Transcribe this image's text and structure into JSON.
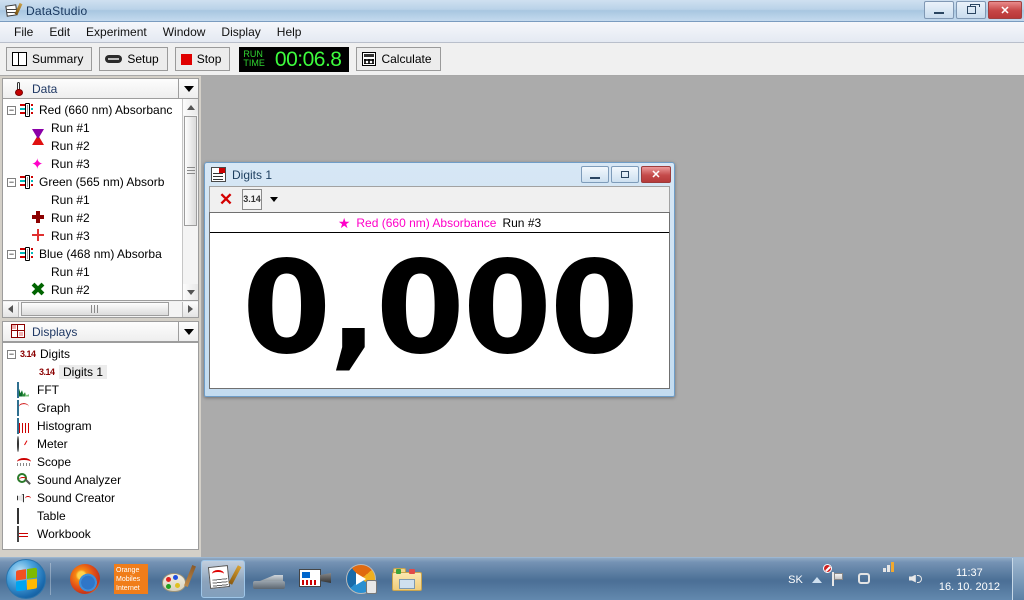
{
  "window": {
    "title": "DataStudio",
    "icon": "datastudio-icon",
    "buttons": {
      "minimize": "–",
      "restore": "❐",
      "close": "✕"
    }
  },
  "menubar": {
    "items": [
      {
        "label": "File"
      },
      {
        "label": "Edit"
      },
      {
        "label": "Experiment"
      },
      {
        "label": "Window"
      },
      {
        "label": "Display"
      },
      {
        "label": "Help"
      }
    ]
  },
  "toolbar": {
    "summary_label": "Summary",
    "setup_label": "Setup",
    "stop_label": "Stop",
    "calculate_label": "Calculate",
    "timer": {
      "label_line1": "RUN",
      "label_line2": "TIME",
      "value": "00:06.8",
      "color": "#3dfb3d"
    }
  },
  "sidebar": {
    "data_panel": {
      "title": "Data",
      "groups": [
        {
          "label": "Red (660 nm) Absorbanc",
          "runs": [
            {
              "label": "Run #1",
              "marker": "triangle-up-marker",
              "color": "#e01010"
            },
            {
              "label": "Run #2",
              "marker": "triangle-down-marker",
              "color": "#8b00a8"
            },
            {
              "label": "Run #3",
              "marker": "star-marker",
              "color": "#ff00c8"
            }
          ]
        },
        {
          "label": "Green (565 nm) Absorb",
          "runs": [
            {
              "label": "Run #1",
              "marker": "square-marker",
              "color": "#00cc00"
            },
            {
              "label": "Run #2",
              "marker": "plus-bold-marker",
              "color": "#8b0000"
            },
            {
              "label": "Run #3",
              "marker": "plus-thin-marker",
              "color": "#e03030"
            }
          ]
        },
        {
          "label": "Blue (468 nm) Absorba",
          "runs": [
            {
              "label": "Run #1",
              "marker": "circle-marker",
              "color": "#0010dd"
            },
            {
              "label": "Run #2",
              "marker": "cross-marker",
              "color": "#006400"
            }
          ]
        }
      ]
    },
    "displays_panel": {
      "title": "Displays",
      "root": {
        "label": "Digits",
        "icon": "pi-icon"
      },
      "selected_child": {
        "label": "Digits 1",
        "icon": "pi-icon"
      },
      "items": [
        {
          "label": "FFT",
          "icon": "fft-icon"
        },
        {
          "label": "Graph",
          "icon": "graph-icon"
        },
        {
          "label": "Histogram",
          "icon": "histogram-icon"
        },
        {
          "label": "Meter",
          "icon": "meter-icon"
        },
        {
          "label": "Scope",
          "icon": "scope-icon"
        },
        {
          "label": "Sound Analyzer",
          "icon": "sound-analyzer-icon"
        },
        {
          "label": "Sound Creator",
          "icon": "sound-creator-icon"
        },
        {
          "label": "Table",
          "icon": "table-icon"
        },
        {
          "label": "Workbook",
          "icon": "workbook-icon"
        }
      ]
    }
  },
  "digits_window": {
    "title": "Digits 1",
    "buttons": {
      "minimize": "–",
      "restore": "❐",
      "close": "✕"
    },
    "toolbar": {
      "remove_label": "✕",
      "digits_label": "3.14",
      "dropdown": "▾"
    },
    "legend": {
      "marker": "star-marker",
      "marker_glyph": "★",
      "measurement": "Red (660 nm) Absorbance",
      "run": "Run #3",
      "color": "#ff00c8"
    },
    "value": "0,000"
  },
  "taskbar": {
    "start_label": "start-orb",
    "quick_launch": [
      {
        "name": "firefox-icon"
      },
      {
        "name": "orange-mobiles-internet-icon",
        "line1": "Orange",
        "line2": "Mobiles",
        "line3": "Internet"
      },
      {
        "name": "paint-icon"
      },
      {
        "name": "datastudio-taskbar-icon",
        "active": true
      },
      {
        "name": "scanner-icon"
      },
      {
        "name": "camera-icon"
      },
      {
        "name": "windows-media-player-icon"
      },
      {
        "name": "folder-icon"
      }
    ],
    "tray": {
      "language": "SK",
      "icons": [
        "action-center-flag-icon",
        "network-icon",
        "signal-bars-icon",
        "volume-icon"
      ],
      "clock_time": "11:37",
      "clock_date": "16. 10. 2012"
    }
  }
}
